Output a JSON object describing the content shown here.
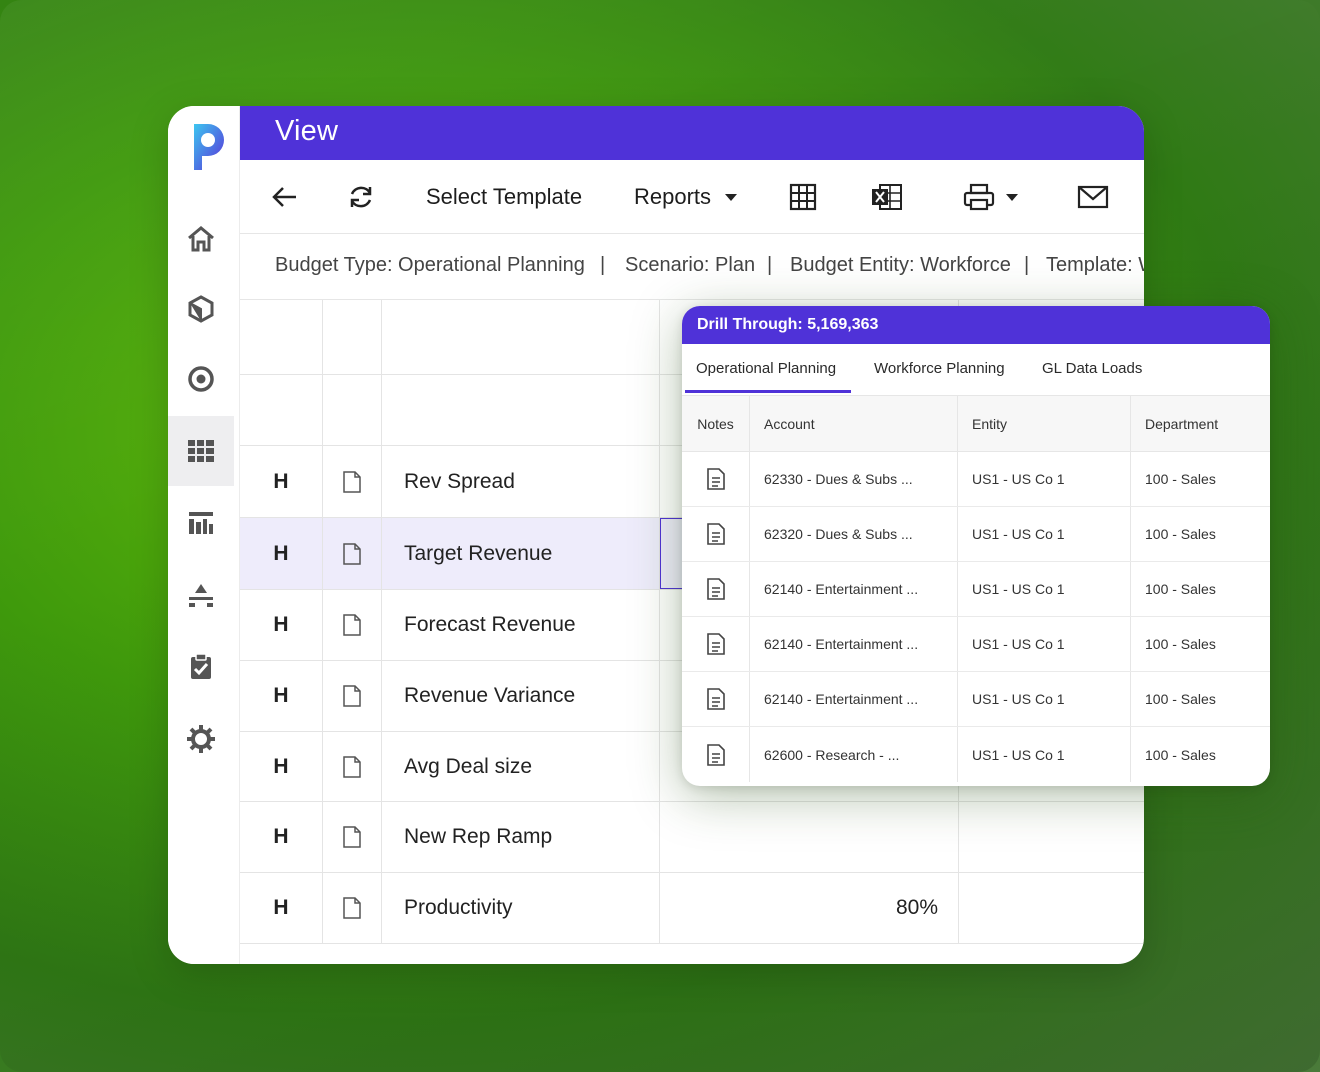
{
  "header": {
    "title": "View"
  },
  "toolbar": {
    "select_template": "Select Template",
    "reports": "Reports"
  },
  "context": {
    "budget_type": "Budget Type: Operational Planning",
    "sep1": "|",
    "scenario": "Scenario: Plan",
    "sep2": "|",
    "budget_entity": "Budget Entity: Workforce",
    "sep3": "|",
    "template": "Template: W"
  },
  "grid": {
    "rows": [
      {
        "h": "H",
        "label": "Rev Spread",
        "value": ""
      },
      {
        "h": "H",
        "label": "Target Revenue",
        "value": ""
      },
      {
        "h": "H",
        "label": "Forecast Revenue",
        "value": ""
      },
      {
        "h": "H",
        "label": "Revenue Variance",
        "value": ""
      },
      {
        "h": "H",
        "label": "Avg Deal size",
        "value": ""
      },
      {
        "h": "H",
        "label": "New Rep Ramp",
        "value": ""
      },
      {
        "h": "H",
        "label": "Productivity",
        "value": "80%"
      }
    ]
  },
  "drill": {
    "title": "Drill Through: 5,169,363",
    "tabs": [
      "Operational Planning",
      "Workforce Planning",
      "GL Data Loads"
    ],
    "columns": [
      "Notes",
      "Account",
      "Entity",
      "Department"
    ],
    "rows": [
      {
        "account": "62330 - Dues & Subs ...",
        "entity": "US1 - US Co 1",
        "department": "100 - Sales"
      },
      {
        "account": "62320 - Dues & Subs ...",
        "entity": "US1 - US Co 1",
        "department": "100 - Sales"
      },
      {
        "account": "62140 - Entertainment ...",
        "entity": "US1 - US Co 1",
        "department": "100 - Sales"
      },
      {
        "account": "62140 - Entertainment ...",
        "entity": "US1 - US Co 1",
        "department": "100 - Sales"
      },
      {
        "account": "62140 - Entertainment ...",
        "entity": "US1 - US Co 1",
        "department": "100 - Sales"
      },
      {
        "account": "62600 - Research - ...",
        "entity": "US1 - US Co 1",
        "department": "100 - Sales"
      }
    ]
  },
  "colors": {
    "brand": "#4f32d8",
    "selected_row": "#eeecfb"
  }
}
